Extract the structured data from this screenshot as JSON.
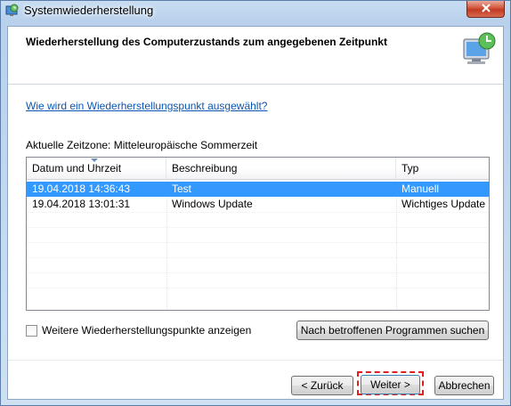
{
  "window": {
    "title": "Systemwiederherstellung",
    "close_label": "×"
  },
  "header": {
    "heading": "Wiederherstellung des Computerzustands zum angegebenen Zeitpunkt"
  },
  "help_link": "Wie wird ein Wiederherstellungspunkt ausgewählt?",
  "timezone_label": "Aktuelle Zeitzone: Mitteleuropäische Sommerzeit",
  "table": {
    "columns": [
      "Datum und Uhrzeit",
      "Beschreibung",
      "Typ"
    ],
    "rows": [
      {
        "date": "19.04.2018 14:36:43",
        "description": "Test",
        "type": "Manuell",
        "selected": true
      },
      {
        "date": "19.04.2018 13:01:31",
        "description": "Windows Update",
        "type": "Wichtiges Update",
        "selected": false
      }
    ]
  },
  "checkbox": {
    "label": "Weitere Wiederherstellungspunkte anzeigen",
    "checked": false
  },
  "buttons": {
    "search_programs": "Nach betroffenen Programmen suchen",
    "back": "< Zurück",
    "next": "Weiter >",
    "cancel": "Abbrechen"
  },
  "colors": {
    "selection": "#3399ff",
    "link": "#0b56b5",
    "highlight_frame": "#e0201c"
  }
}
